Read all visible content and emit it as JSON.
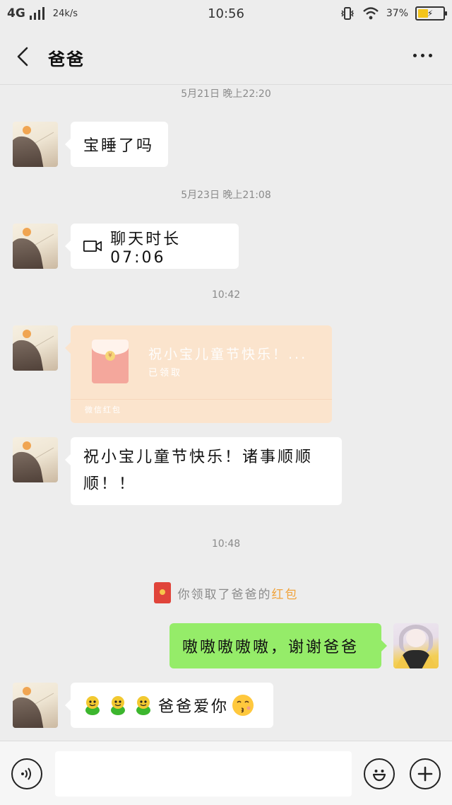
{
  "status_bar": {
    "network": "4G",
    "speed": "24k/s",
    "time": "10:56",
    "battery": "37%",
    "icons": [
      "signal-icon",
      "vibrate-icon",
      "wifi-icon",
      "battery-icon"
    ]
  },
  "header": {
    "title": "爸爸",
    "back_icon": "back-arrow-icon",
    "more_icon": "more-dots-icon"
  },
  "messages": [
    {
      "type": "timestamp",
      "text": "5月21日 晚上22:20"
    },
    {
      "type": "text",
      "side": "left",
      "text": "宝睡了吗"
    },
    {
      "type": "timestamp",
      "text": "5月23日 晚上21:08"
    },
    {
      "type": "video_call",
      "side": "left",
      "text": "聊天时长 07:06",
      "icon": "video-camera-icon"
    },
    {
      "type": "timestamp",
      "text": "10:42"
    },
    {
      "type": "red_packet",
      "side": "left",
      "title": "祝小宝儿童节快乐！...",
      "status": "已领取",
      "label": "微信红包"
    },
    {
      "type": "text",
      "side": "left",
      "line1": "祝小宝儿童节快乐！诸事顺顺",
      "line2": "顺！！"
    },
    {
      "type": "timestamp",
      "text": "10:48"
    },
    {
      "type": "system",
      "prefix": "你领取了爸爸的",
      "highlight": "红包"
    },
    {
      "type": "text",
      "side": "right",
      "text": "嗷嗷嗷嗷嗷，谢谢爸爸"
    },
    {
      "type": "text",
      "side": "left",
      "text": "爸爸爱你",
      "leading_emoji": "frog-emoji x3",
      "trailing_emoji": "kissing-face-emoji"
    }
  ],
  "input_bar": {
    "voice_icon": "voice-icon",
    "placeholder": "",
    "emoji_icon": "smiley-icon",
    "plus_icon": "plus-icon"
  },
  "colors": {
    "background": "#ededed",
    "sent_bubble": "#95ec69",
    "received_bubble": "#ffffff",
    "red_packet_opened": "#fbe4cd",
    "highlight": "#f0a33c"
  }
}
